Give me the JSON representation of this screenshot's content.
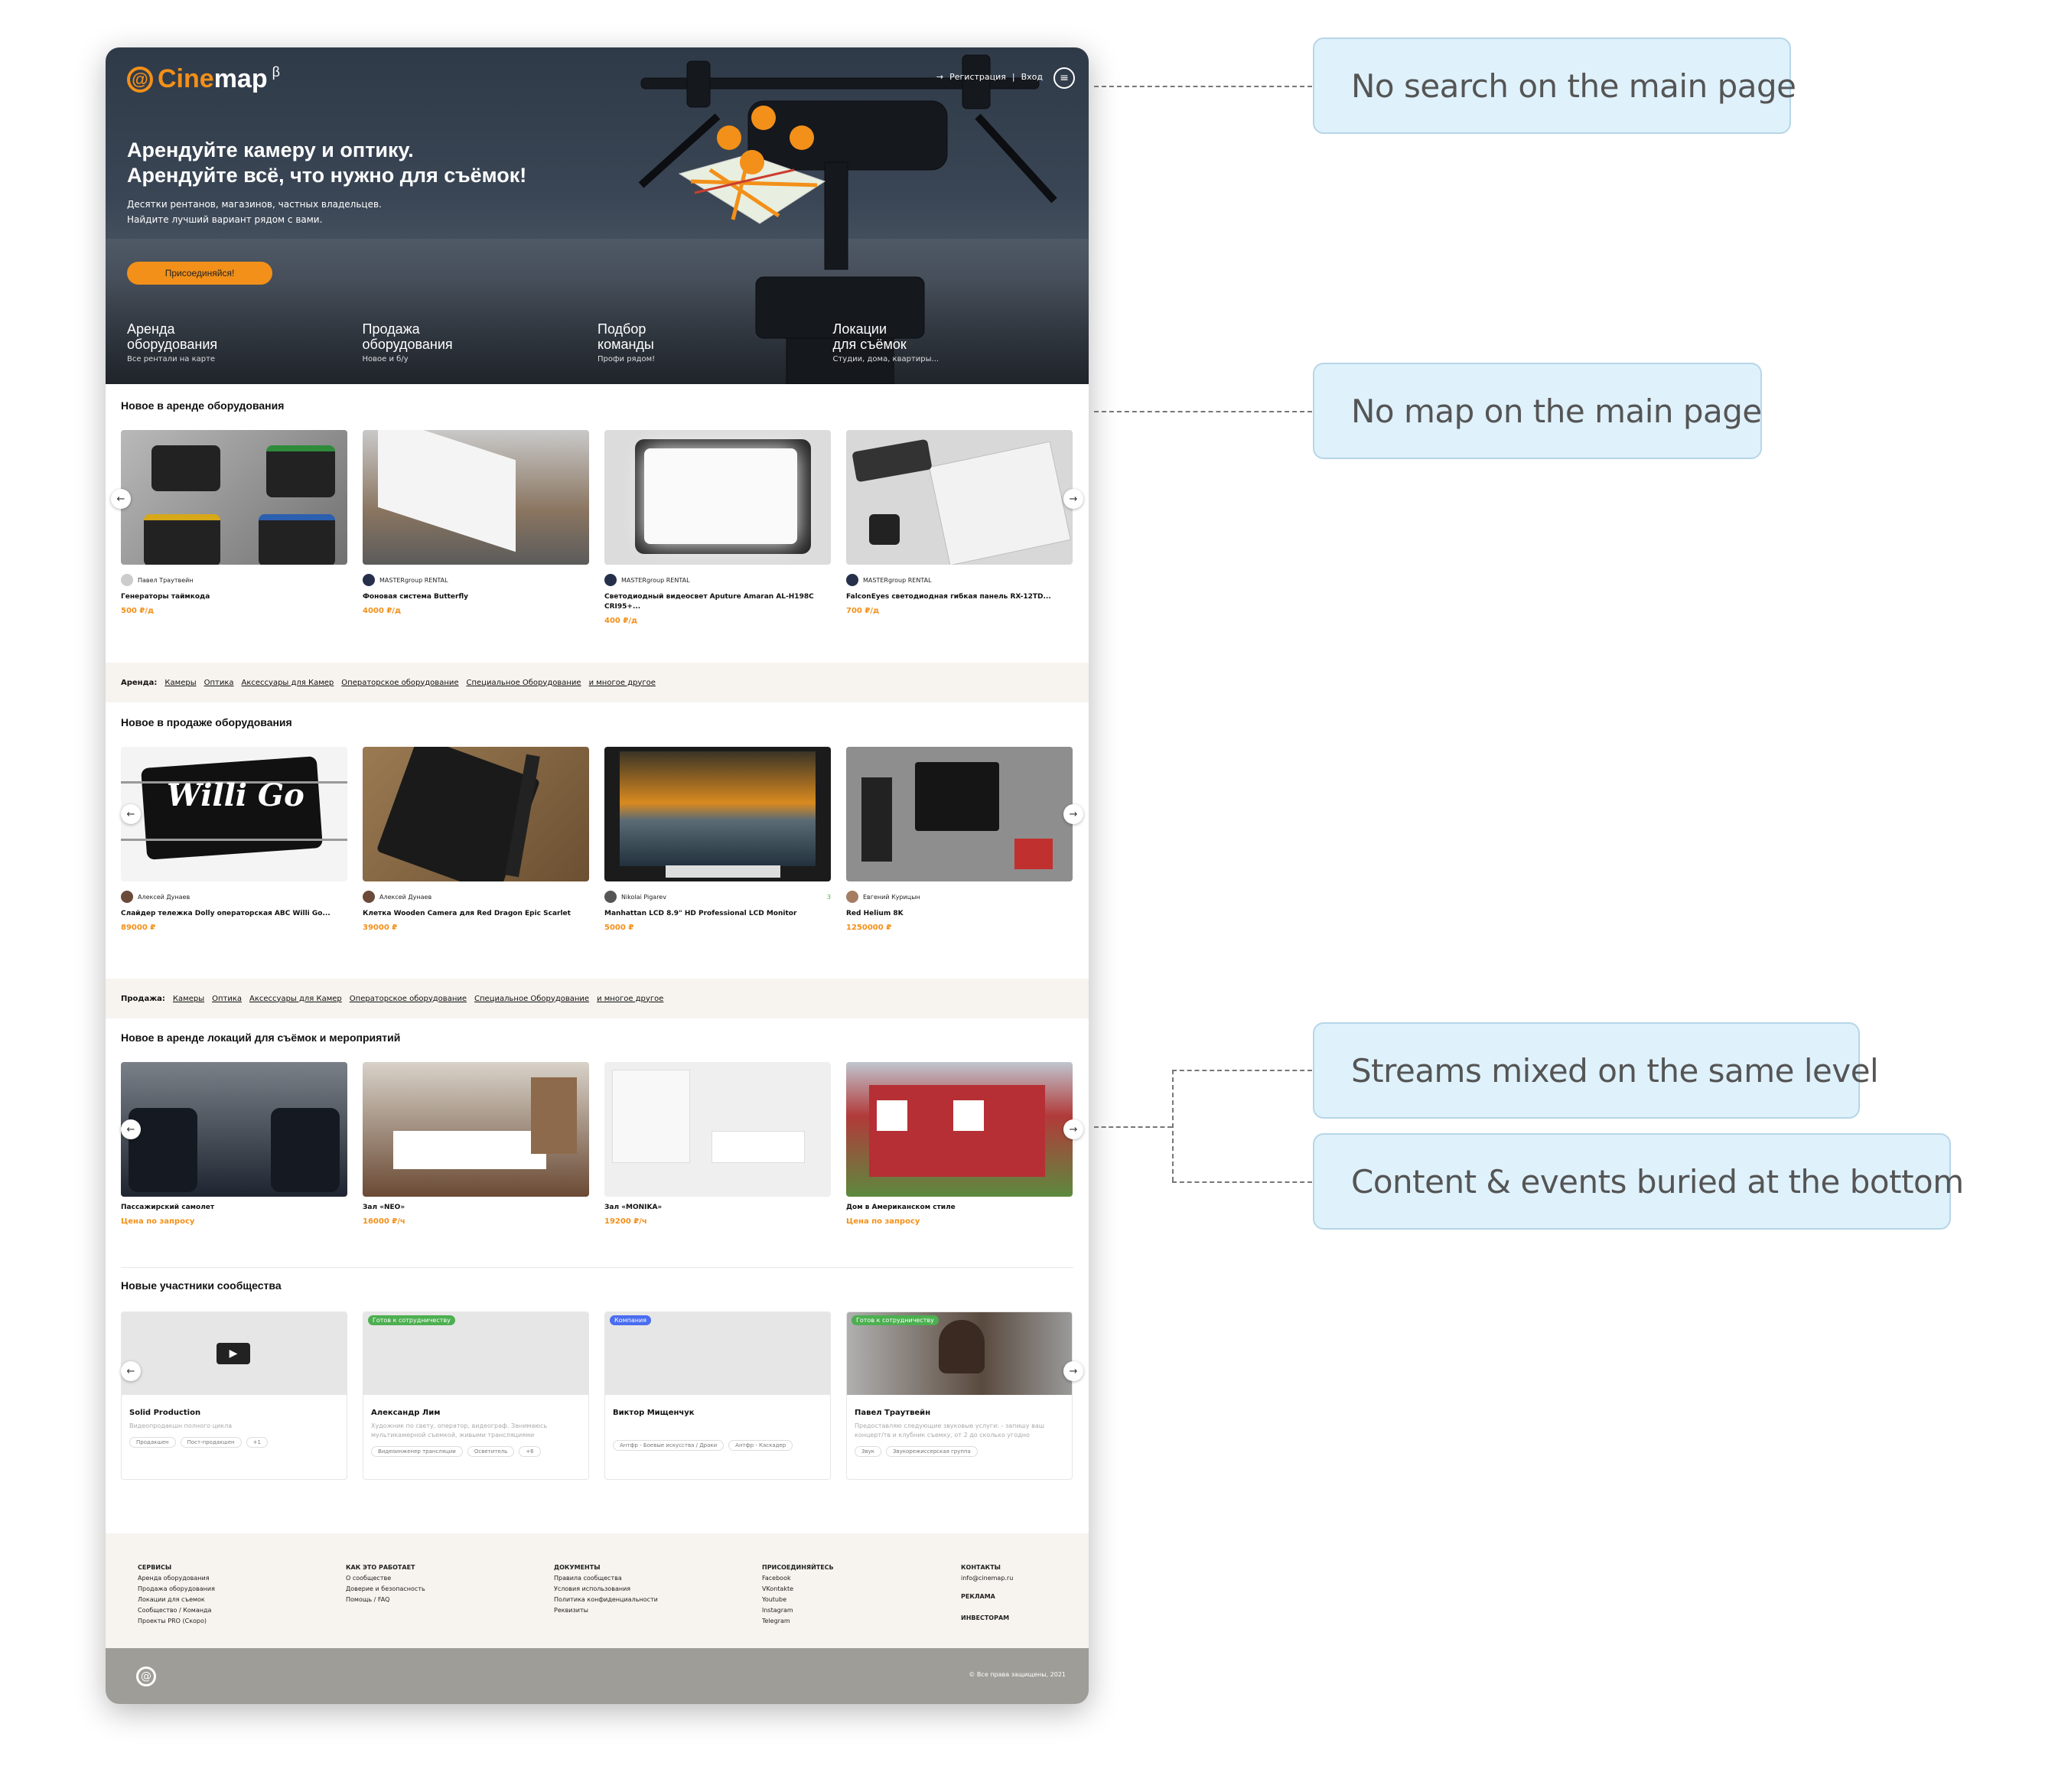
{
  "header": {
    "logo_prefix": "@",
    "logo_word_a": "Cine",
    "logo_word_b": "map",
    "logo_beta": "β",
    "register": "Регистрация",
    "separator": "|",
    "login": "Вход",
    "arrow": "→",
    "menu_icon": "menu-icon"
  },
  "hero": {
    "title_line1": "Арендуйте камеру и оптику.",
    "title_line2": "Арендуйте всё, что нужно для съёмок!",
    "sub_line1": "Десятки рентанов, магазинов, частных владельцев.",
    "sub_line2": "Найдите лучший вариант рядом с вами.",
    "join_label": "Присоединяйся!",
    "categories": [
      {
        "title1": "Аренда",
        "title2": "оборудования",
        "desc": "Все рентали на карте"
      },
      {
        "title1": "Продажа",
        "title2": "оборудования",
        "desc": "Новое и б/у"
      },
      {
        "title1": "Подбор",
        "title2": "команды",
        "desc": "Профи рядом!"
      },
      {
        "title1": "Локации",
        "title2": "для съёмок",
        "desc": "Студии, дома, квартиры..."
      }
    ]
  },
  "rent_section": {
    "title": "Новое в аренде оборудования",
    "items": [
      {
        "owner": "Павел Траутвейн",
        "name": "Генераторы таймкода",
        "price": "500",
        "unit": "₽/д"
      },
      {
        "owner": "MASTERgroup RENTAL",
        "name": "Фоновая система Butterfly",
        "price": "4000",
        "unit": "₽/д"
      },
      {
        "owner": "MASTERgroup RENTAL",
        "name": "Светодиодный видеосвет Aputure Amaran AL-H198C CRI95+...",
        "price": "400",
        "unit": "₽/д"
      },
      {
        "owner": "MASTERgroup RENTAL",
        "name": "FalconEyes светодиодная гибкая панель RX-12TD...",
        "price": "700",
        "unit": "₽/д"
      }
    ]
  },
  "rent_strip": {
    "label": "Аренда:",
    "links": [
      "Камеры",
      "Оптика",
      "Аксессуары для Камер",
      "Операторское оборудование",
      "Специальное Оборудование",
      "и многое другое"
    ]
  },
  "sale_section": {
    "title": "Новое в продаже оборудования",
    "items": [
      {
        "owner": "Алексей Дунаев",
        "name": "Слайдер тележка Dolly операторская ABC Willi Go...",
        "price": "89000",
        "unit": "₽"
      },
      {
        "owner": "Алексей Дунаев",
        "name": "Клетка Wooden Camera для Red Dragon Epic Scarlet",
        "price": "39000",
        "unit": "₽"
      },
      {
        "owner": "Nikolai Pigarev",
        "name": "Manhattan LCD 8.9\" HD Professional LCD Monitor",
        "price": "5000",
        "unit": "₽"
      },
      {
        "owner": "Евгений Курицын",
        "name": "Red Helium 8K",
        "price": "1250000",
        "unit": "₽"
      }
    ],
    "willi_text": "Willi Go",
    "likes": "3"
  },
  "sale_strip": {
    "label": "Продажа:",
    "links": [
      "Камеры",
      "Оптика",
      "Аксессуары для Камер",
      "Операторское оборудование",
      "Специальное Оборудование",
      "и многое другое"
    ]
  },
  "locations_section": {
    "title": "Новое в аренде локаций для съёмок и мероприятий",
    "items": [
      {
        "name": "Пассажирский самолет",
        "price": "Цена по запросу",
        "unit": ""
      },
      {
        "name": "Зал «NEO»",
        "price": "16000",
        "unit": "₽/ч"
      },
      {
        "name": "Зал «MONIKA»",
        "price": "19200",
        "unit": "₽/ч"
      },
      {
        "name": "Дом в Американском стиле",
        "price": "Цена по запросу",
        "unit": ""
      }
    ]
  },
  "community_section": {
    "title": "Новые участники сообщества",
    "items": [
      {
        "badge": "",
        "name": "Solid Production",
        "desc": "Видеопродакшн полного цикла",
        "tags": [
          "Продакшен",
          "Пост-продакшен",
          "+1"
        ]
      },
      {
        "badge": "Готов к сотрудничеству",
        "name": "Александр Лим",
        "desc": "Художник по свету, оператор, видеограф. Занимаюсь мультикамерной съемкой, живыми трансляциями",
        "tags": [
          "Видеоинженер трансляции",
          "Осветитель",
          "+6"
        ]
      },
      {
        "badge": "Компания",
        "name": "Виктор Мищенчук",
        "desc": "",
        "tags": [
          "Антфр - Боевые искусства / Драки",
          "Антфр - Каскадер"
        ]
      },
      {
        "badge": "Готов к сотрудничеству",
        "name": "Павел Траутвейн",
        "desc": "Предоставляю следующие звуковые услуги: - запишу ваш концерт/тв и клубник съемку, от 2 до сколько угодно",
        "tags": [
          "Звук",
          "Звукорежиссерская группа"
        ]
      }
    ]
  },
  "footer": {
    "columns": [
      {
        "heading": "СЕРВИСЫ",
        "links": [
          "Аренда оборудования",
          "Продажа оборудования",
          "Локации для съемок",
          "Сообщество / Команда",
          "Проекты PRO (Скоро)"
        ]
      },
      {
        "heading": "КАК ЭТО РАБОТАЕТ",
        "links": [
          "О сообществе",
          "Доверие и безопасность",
          "Помощь / FAQ"
        ]
      },
      {
        "heading": "ДОКУМЕНТЫ",
        "links": [
          "Правила сообщества",
          "Условия использования",
          "Политика конфиденциальности",
          "Реквизиты"
        ]
      },
      {
        "heading": "ПРИСОЕДИНЯЙТЕСЬ",
        "links": [
          "Facebook",
          "VKontakte",
          "Youtube",
          "Instagram",
          "Telegram"
        ]
      }
    ],
    "contacts_heading": "КОНТАКТЫ",
    "contacts_email": "info@cinemap.ru",
    "ads": "РЕКЛАМА",
    "investors": "ИНВЕСТОРАМ",
    "copyright": "© Все права защищены, 2021"
  },
  "callouts": {
    "c1": "No search on the main page",
    "c2": "No map on the main page",
    "c3": "Streams mixed on the same level",
    "c4": "Content & events buried at the bottom"
  },
  "colors": {
    "accent": "#f39019",
    "callout_bg": "#dff1fb",
    "strip_bg": "#f7f4ef"
  }
}
